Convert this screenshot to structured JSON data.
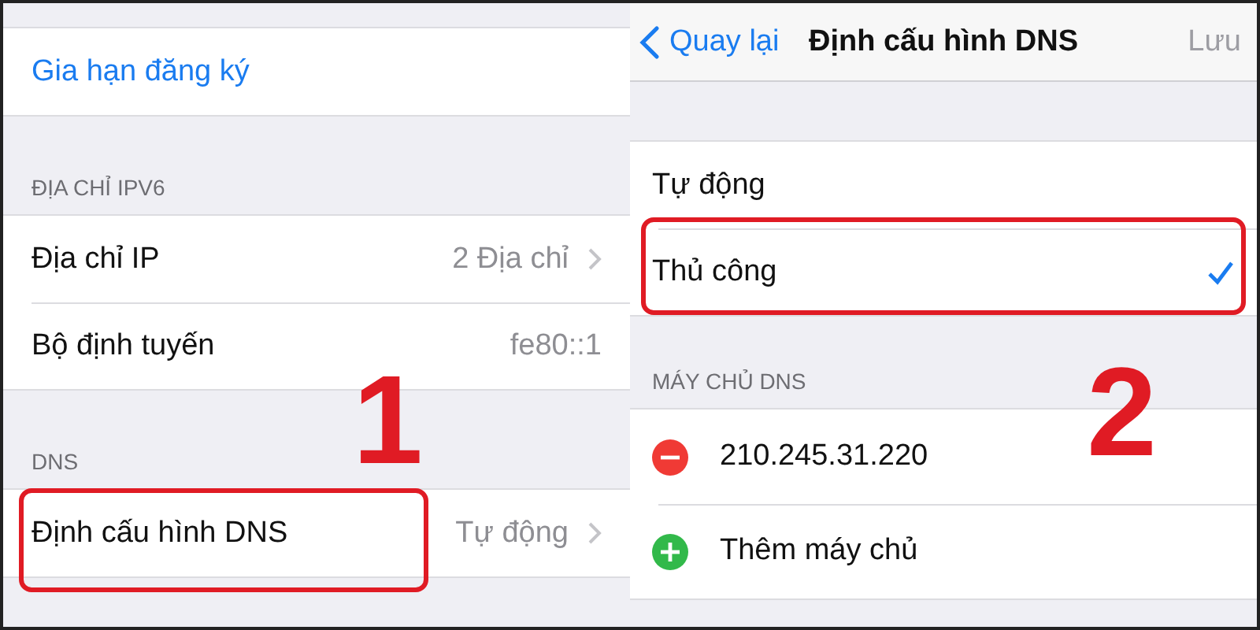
{
  "left": {
    "top_link": "Gia hạn đăng ký",
    "sections": [
      {
        "header": "ĐỊA CHỈ IPV6",
        "rows": [
          {
            "label": "Địa chỉ IP",
            "value": "2 Địa chỉ",
            "chevron": true
          },
          {
            "label": "Bộ định tuyến",
            "value": "fe80::1",
            "chevron": false
          }
        ]
      },
      {
        "header": "DNS",
        "rows": [
          {
            "label": "Định cấu hình DNS",
            "value": "Tự động",
            "chevron": true
          }
        ]
      }
    ]
  },
  "right": {
    "nav": {
      "back": "Quay lại",
      "title": "Định cấu hình DNS",
      "save": {
        "label": "Lưu",
        "disabled": true
      }
    },
    "modes": [
      {
        "label": "Tự động",
        "selected": false
      },
      {
        "label": "Thủ công",
        "selected": true
      }
    ],
    "servers_header": "MÁY CHỦ DNS",
    "servers": [
      {
        "kind": "remove",
        "label": "210.245.31.220"
      },
      {
        "kind": "add",
        "label": "Thêm máy chủ"
      }
    ]
  },
  "annotations": [
    {
      "number": "1"
    },
    {
      "number": "2"
    }
  ]
}
